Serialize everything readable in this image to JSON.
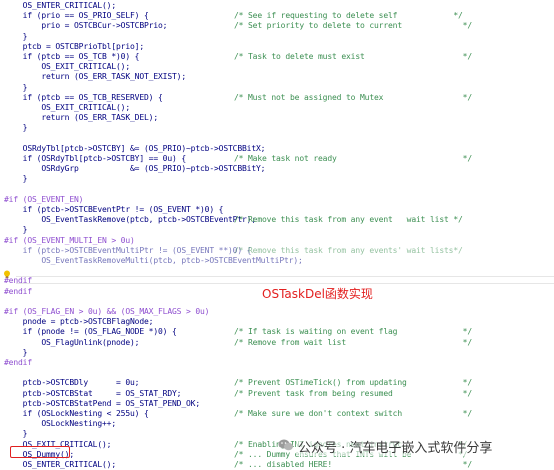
{
  "editor": {
    "lines": [
      {
        "code": "    OS_ENTER_CRITICAL();",
        "comment": ""
      },
      {
        "code": "    if (prio == OS_PRIO_SELF) {",
        "comment": "/* See if requesting to delete self            */"
      },
      {
        "code": "        prio = OSTCBCur->OSTCBPrio;",
        "comment": "/* Set priority to delete to current             */"
      },
      {
        "code": "    }",
        "comment": ""
      },
      {
        "code": "    ptcb = OSTCBPrioTbl[prio];",
        "comment": ""
      },
      {
        "code": "    if (ptcb == OS_TCB *)0) {",
        "comment": "/* Task to delete must exist                     */"
      },
      {
        "code": "        OS_EXIT_CRITICAL();",
        "comment": ""
      },
      {
        "code": "        return (OS_ERR_TASK_NOT_EXIST);",
        "comment": ""
      },
      {
        "code": "    }",
        "comment": ""
      },
      {
        "code": "    if (ptcb == OS_TCB_RESERVED) {",
        "comment": "/* Must not be assigned to Mutex                 */"
      },
      {
        "code": "        OS_EXIT_CRITICAL();",
        "comment": ""
      },
      {
        "code": "        return (OS_ERR_TASK_DEL);",
        "comment": ""
      },
      {
        "code": "    }",
        "comment": ""
      },
      {
        "code": "",
        "comment": ""
      },
      {
        "code": "    OSRdyTbl[ptcb->OSTCBY] &= (OS_PRIO)~ptcb->OSTCBBitX;",
        "comment": ""
      },
      {
        "code": "    if (OSRdyTbl[ptcb->OSTCBY] == 0u) {",
        "comment": "/* Make task not ready                           */"
      },
      {
        "code": "        OSRdyGrp           &= (OS_PRIO)~ptcb->OSTCBBitY;",
        "comment": ""
      },
      {
        "code": "    }",
        "comment": ""
      },
      {
        "code": "",
        "comment": ""
      },
      {
        "code": "#if (OS_EVENT_EN)",
        "comment": ""
      },
      {
        "code": "    if (ptcb->OSTCBEventPtr != (OS_EVENT *)0) {",
        "comment": ""
      },
      {
        "code": "        OS_EventTaskRemove(ptcb, ptcb->OSTCBEventPtr);",
        "comment": "/* Remove this task from any event   wait list */"
      },
      {
        "code": "    }",
        "comment": ""
      },
      {
        "code": "#if (OS_EVENT_MULTI_EN > 0u)",
        "comment": ""
      },
      {
        "code": "    if (ptcb->OSTCBEventMultiPtr != (OS_EVENT **)0) {",
        "comment": "/* Remove this task from any events' wait lists*/"
      },
      {
        "code": "        OS_EventTaskRemoveMulti(ptcb, ptcb->OSTCBEventMultiPtr);",
        "comment": ""
      },
      {
        "code": "",
        "comment": ""
      },
      {
        "code": "#endif",
        "comment": ""
      },
      {
        "code": "#endif",
        "comment": ""
      },
      {
        "code": "",
        "comment": ""
      },
      {
        "code": "#if (OS_FLAG_EN > 0u) && (OS_MAX_FLAGS > 0u)",
        "comment": ""
      },
      {
        "code": "    pnode = ptcb->OSTCBFlagNode;",
        "comment": ""
      },
      {
        "code": "    if (pnode != (OS_FLAG_NODE *)0) {",
        "comment": "/* If task is waiting on event flag              */"
      },
      {
        "code": "        OS_FlagUnlink(pnode);",
        "comment": "/* Remove from wait list                         */"
      },
      {
        "code": "    }",
        "comment": ""
      },
      {
        "code": "#endif",
        "comment": ""
      },
      {
        "code": "",
        "comment": ""
      },
      {
        "code": "    ptcb->OSTCBDly      = 0u;",
        "comment": "/* Prevent OSTimeTick() from updating            */"
      },
      {
        "code": "    ptcb->OSTCBStat     = OS_STAT_RDY;",
        "comment": "/* Prevent task from being resumed               */"
      },
      {
        "code": "    ptcb->OSTCBStatPend = OS_STAT_PEND_OK;",
        "comment": ""
      },
      {
        "code": "    if (OSLockNesting < 255u) {",
        "comment": "/* Make sure we don't context switch             */"
      },
      {
        "code": "        OSLockNesting++;",
        "comment": ""
      },
      {
        "code": "    }",
        "comment": ""
      },
      {
        "code": "    OS_EXIT_CRITICAL();",
        "comment": "/* Enabling INT ignores next instruc.           */"
      },
      {
        "code": "    OS_Dummy();",
        "comment": "/* ... Dummy ensures that INTs will be          */"
      },
      {
        "code": "    OS_ENTER_CRITICAL();",
        "comment": "/* ... disabled HERE!                            */"
      }
    ]
  },
  "annotation": {
    "title": "OSTaskDel函数实现"
  },
  "watermark": {
    "text": "公众号 · 汽车电子嵌入式软件分享"
  },
  "colors": {
    "code": "#000080",
    "comment": "#3c8f52",
    "accent_red": "#e32020",
    "highlight_box": "#e02020"
  }
}
